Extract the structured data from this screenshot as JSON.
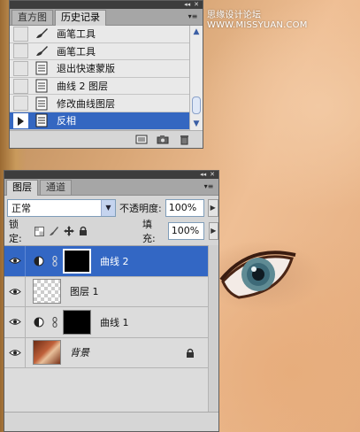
{
  "watermark": "思缘设计论坛 WWW.MISSYUAN.COM",
  "history_panel": {
    "tabs": [
      "直方图",
      "历史记录"
    ],
    "active_tab": 1,
    "menu_icon": "panel-menu-icon",
    "items": [
      {
        "label": "画笔工具",
        "icon": "brush-icon",
        "selected": false
      },
      {
        "label": "画笔工具",
        "icon": "brush-icon",
        "selected": false
      },
      {
        "label": "退出快速蒙版",
        "icon": "history-state-icon",
        "selected": false
      },
      {
        "label": "曲线 2 图层",
        "icon": "history-state-icon",
        "selected": false
      },
      {
        "label": "修改曲线图层",
        "icon": "history-state-icon",
        "selected": false
      },
      {
        "label": "反相",
        "icon": "history-state-icon",
        "selected": true
      }
    ],
    "footer_icons": [
      "new-document-from-state-icon",
      "camera-icon",
      "trash-icon"
    ]
  },
  "layers_panel": {
    "tabs": [
      "图层",
      "通道"
    ],
    "active_tab": 0,
    "blend_mode": "正常",
    "opacity_label": "不透明度:",
    "opacity_value": "100%",
    "lock_label": "锁定:",
    "fill_label": "填充:",
    "fill_value": "100%",
    "layers": [
      {
        "name": "曲线 2",
        "type": "adjustment",
        "selected": true,
        "visible": true
      },
      {
        "name": "图层 1",
        "type": "pixel-transparent",
        "selected": false,
        "visible": true
      },
      {
        "name": "曲线 1",
        "type": "adjustment",
        "selected": false,
        "visible": true
      },
      {
        "name": "背景",
        "type": "background",
        "selected": false,
        "visible": true,
        "locked": true
      }
    ]
  },
  "colors": {
    "selection": "#3467c1",
    "panel_bg": "#d6d6d6",
    "panel_header": "#3d3d3d"
  }
}
